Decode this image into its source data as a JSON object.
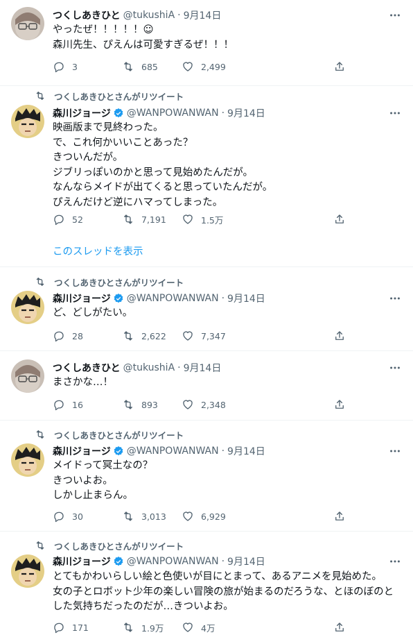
{
  "colors": {
    "text": "#0f1419",
    "muted": "#536471",
    "accent": "#1d9bf0",
    "divider": "#eff3f4"
  },
  "more_icon": "more-horizontal-icon",
  "tweets": [
    {
      "retweet_label": "",
      "name": "つくしあきひと",
      "verified": false,
      "handle": "@tukushiA",
      "date": "9月14日",
      "text": "やったぜ！！！！！☺\n森川先生、ぴえんは可愛すぎるぜ！！！",
      "replies": "3",
      "retweets": "685",
      "likes": "2,499"
    },
    {
      "retweet_label": "つくしあきひとさんがリツイート",
      "name": "森川ジョージ",
      "verified": true,
      "handle": "@WANPOWANWAN",
      "date": "9月14日",
      "text": "映画版まで見終わった。\nで、これ何かいいことあった？\nきついんだが。\nジブリっぽいのかと思って見始めたんだが。\nなんならメイドが出てくると思っていたんだが。\nぴえんだけど逆にハマってしまった。",
      "replies": "52",
      "retweets": "7,191",
      "likes": "1.5万",
      "thread_link": "このスレッドを表示"
    },
    {
      "retweet_label": "つくしあきひとさんがリツイート",
      "name": "森川ジョージ",
      "verified": true,
      "handle": "@WANPOWANWAN",
      "date": "9月14日",
      "text": "ど、どしがたい。",
      "replies": "28",
      "retweets": "2,622",
      "likes": "7,347"
    },
    {
      "retweet_label": "",
      "name": "つくしあきひと",
      "verified": false,
      "handle": "@tukushiA",
      "date": "9月14日",
      "text": "まさかな…！",
      "replies": "16",
      "retweets": "893",
      "likes": "2,348"
    },
    {
      "retweet_label": "つくしあきひとさんがリツイート",
      "name": "森川ジョージ",
      "verified": true,
      "handle": "@WANPOWANWAN",
      "date": "9月14日",
      "text": "メイドって冥土なの？\nきついよお。\nしかし止まらん。",
      "replies": "30",
      "retweets": "3,013",
      "likes": "6,929"
    },
    {
      "retweet_label": "つくしあきひとさんがリツイート",
      "name": "森川ジョージ",
      "verified": true,
      "handle": "@WANPOWANWAN",
      "date": "9月14日",
      "text": "とてもかわいらしい絵と色使いが目にとまって、あるアニメを見始めた。\n女の子とロボット少年の楽しい冒険の旅が始まるのだろうな、とほのぼのとした気持ちだったのだが…きついよお。",
      "replies": "171",
      "retweets": "1.9万",
      "likes": "4万"
    }
  ]
}
